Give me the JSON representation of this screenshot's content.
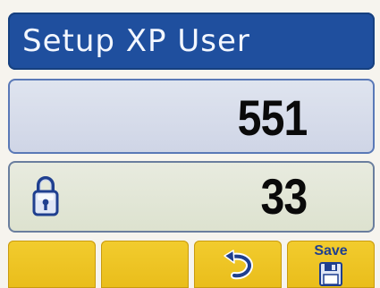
{
  "title": "Setup XP User",
  "main_field": {
    "value": "551"
  },
  "secondary_field": {
    "value": "33",
    "icon": "lock-icon"
  },
  "softkeys": [
    {
      "label": ""
    },
    {
      "label": ""
    },
    {
      "icon": "back-arrow-icon",
      "label": ""
    },
    {
      "label": "Save",
      "icon": "floppy-disk-icon"
    }
  ],
  "colors": {
    "title_bar": "#1f4f9e",
    "softkey": "#f2cc2e",
    "field_border": "#5a79b7"
  }
}
